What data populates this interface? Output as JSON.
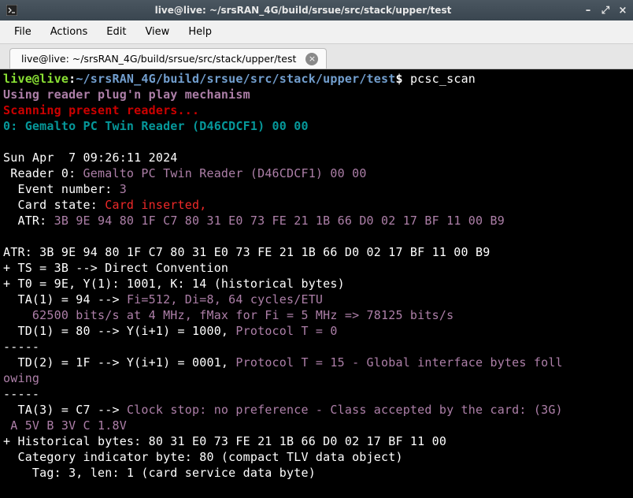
{
  "window": {
    "title": "live@live: ~/srsRAN_4G/build/srsue/src/stack/upper/test",
    "app_icon": "terminal-icon",
    "minimize": "–",
    "maximize": "⤢",
    "close": "×"
  },
  "menu": {
    "file": "File",
    "actions": "Actions",
    "edit": "Edit",
    "view": "View",
    "help": "Help"
  },
  "tab": {
    "label": "live@live: ~/srsRAN_4G/build/srsue/src/stack/upper/test",
    "close": "×"
  },
  "prompt": {
    "user_host": "live@live",
    "colon": ":",
    "tilde": "~",
    "path": "/srsRAN_4G/build/srsue/src/stack/upper/test",
    "dollar": "$ ",
    "command": "pcsc_scan"
  },
  "out": {
    "l1": "Using reader plug'n play mechanism",
    "l2": "Scanning present readers...",
    "l3": "0: Gemalto PC Twin Reader (D46CDCF1) 00 00",
    "blank": " ",
    "ts": "Sun Apr  7 09:26:11 2024",
    "reader_lbl": " Reader 0: ",
    "reader_val": "Gemalto PC Twin Reader (D46CDCF1) 00 00",
    "event_lbl": "  Event number: ",
    "event_val": "3",
    "card_lbl": "  Card state: ",
    "card_val": "Card inserted, ",
    "atr_lbl": "  ATR: ",
    "atr_val": "3B 9E 94 80 1F C7 80 31 E0 73 FE 21 1B 66 D0 02 17 BF 11 00 B9",
    "atr2": "ATR: 3B 9E 94 80 1F C7 80 31 E0 73 FE 21 1B 66 D0 02 17 BF 11 00 B9",
    "ts_line": "+ TS = 3B --> Direct Convention",
    "t0": "+ T0 = 9E, Y(1): 1001, K: 14 (historical bytes)",
    "ta1_a": "  TA(1) = 94 --> ",
    "ta1_b": "Fi=512, Di=8, 64 cycles/ETU",
    "ta1_c": "    62500 bits/s at 4 MHz, fMax for Fi = 5 MHz => 78125 bits/s",
    "td1_a": "  TD(1) = 80 --> Y(i+1) = 1000, ",
    "td1_b": "Protocol T = 0",
    "dash": "-----",
    "td2_a": "  TD(2) = 1F --> Y(i+1) = 0001, ",
    "td2_b": "Protocol T = 15 - Global interface bytes foll",
    "td2_c": "owing",
    "ta3_a": "  TA(3) = C7 --> ",
    "ta3_b": "Clock stop: no preference - Class accepted by the card: (3G)",
    "ta3_c": " A 5V B 3V C 1.8V",
    "hist": "+ Historical bytes: 80 31 E0 73 FE 21 1B 66 D0 02 17 BF 11 00",
    "cat": "  Category indicator byte: 80 (compact TLV data object)",
    "tag": "    Tag: 3, len: 1 (card service data byte)"
  }
}
